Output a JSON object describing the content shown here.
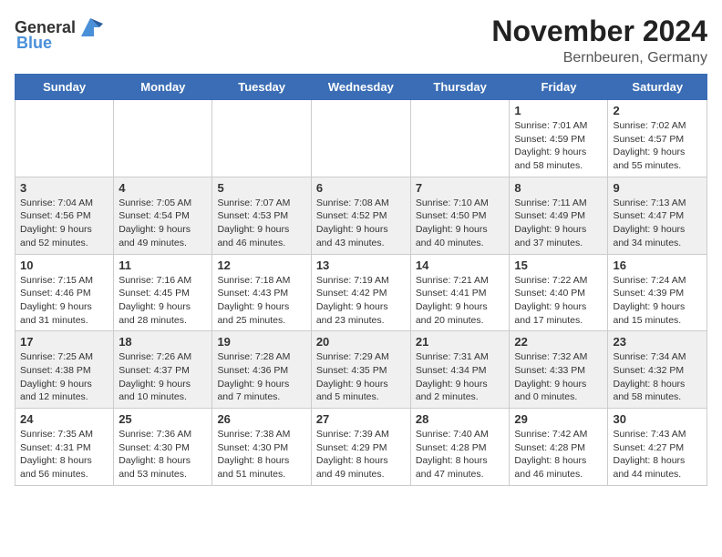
{
  "logo": {
    "general": "General",
    "blue": "Blue"
  },
  "title": "November 2024",
  "location": "Bernbeuren, Germany",
  "days_of_week": [
    "Sunday",
    "Monday",
    "Tuesday",
    "Wednesday",
    "Thursday",
    "Friday",
    "Saturday"
  ],
  "weeks": [
    [
      {
        "day": "",
        "info": ""
      },
      {
        "day": "",
        "info": ""
      },
      {
        "day": "",
        "info": ""
      },
      {
        "day": "",
        "info": ""
      },
      {
        "day": "",
        "info": ""
      },
      {
        "day": "1",
        "info": "Sunrise: 7:01 AM\nSunset: 4:59 PM\nDaylight: 9 hours and 58 minutes."
      },
      {
        "day": "2",
        "info": "Sunrise: 7:02 AM\nSunset: 4:57 PM\nDaylight: 9 hours and 55 minutes."
      }
    ],
    [
      {
        "day": "3",
        "info": "Sunrise: 7:04 AM\nSunset: 4:56 PM\nDaylight: 9 hours and 52 minutes."
      },
      {
        "day": "4",
        "info": "Sunrise: 7:05 AM\nSunset: 4:54 PM\nDaylight: 9 hours and 49 minutes."
      },
      {
        "day": "5",
        "info": "Sunrise: 7:07 AM\nSunset: 4:53 PM\nDaylight: 9 hours and 46 minutes."
      },
      {
        "day": "6",
        "info": "Sunrise: 7:08 AM\nSunset: 4:52 PM\nDaylight: 9 hours and 43 minutes."
      },
      {
        "day": "7",
        "info": "Sunrise: 7:10 AM\nSunset: 4:50 PM\nDaylight: 9 hours and 40 minutes."
      },
      {
        "day": "8",
        "info": "Sunrise: 7:11 AM\nSunset: 4:49 PM\nDaylight: 9 hours and 37 minutes."
      },
      {
        "day": "9",
        "info": "Sunrise: 7:13 AM\nSunset: 4:47 PM\nDaylight: 9 hours and 34 minutes."
      }
    ],
    [
      {
        "day": "10",
        "info": "Sunrise: 7:15 AM\nSunset: 4:46 PM\nDaylight: 9 hours and 31 minutes."
      },
      {
        "day": "11",
        "info": "Sunrise: 7:16 AM\nSunset: 4:45 PM\nDaylight: 9 hours and 28 minutes."
      },
      {
        "day": "12",
        "info": "Sunrise: 7:18 AM\nSunset: 4:43 PM\nDaylight: 9 hours and 25 minutes."
      },
      {
        "day": "13",
        "info": "Sunrise: 7:19 AM\nSunset: 4:42 PM\nDaylight: 9 hours and 23 minutes."
      },
      {
        "day": "14",
        "info": "Sunrise: 7:21 AM\nSunset: 4:41 PM\nDaylight: 9 hours and 20 minutes."
      },
      {
        "day": "15",
        "info": "Sunrise: 7:22 AM\nSunset: 4:40 PM\nDaylight: 9 hours and 17 minutes."
      },
      {
        "day": "16",
        "info": "Sunrise: 7:24 AM\nSunset: 4:39 PM\nDaylight: 9 hours and 15 minutes."
      }
    ],
    [
      {
        "day": "17",
        "info": "Sunrise: 7:25 AM\nSunset: 4:38 PM\nDaylight: 9 hours and 12 minutes."
      },
      {
        "day": "18",
        "info": "Sunrise: 7:26 AM\nSunset: 4:37 PM\nDaylight: 9 hours and 10 minutes."
      },
      {
        "day": "19",
        "info": "Sunrise: 7:28 AM\nSunset: 4:36 PM\nDaylight: 9 hours and 7 minutes."
      },
      {
        "day": "20",
        "info": "Sunrise: 7:29 AM\nSunset: 4:35 PM\nDaylight: 9 hours and 5 minutes."
      },
      {
        "day": "21",
        "info": "Sunrise: 7:31 AM\nSunset: 4:34 PM\nDaylight: 9 hours and 2 minutes."
      },
      {
        "day": "22",
        "info": "Sunrise: 7:32 AM\nSunset: 4:33 PM\nDaylight: 9 hours and 0 minutes."
      },
      {
        "day": "23",
        "info": "Sunrise: 7:34 AM\nSunset: 4:32 PM\nDaylight: 8 hours and 58 minutes."
      }
    ],
    [
      {
        "day": "24",
        "info": "Sunrise: 7:35 AM\nSunset: 4:31 PM\nDaylight: 8 hours and 56 minutes."
      },
      {
        "day": "25",
        "info": "Sunrise: 7:36 AM\nSunset: 4:30 PM\nDaylight: 8 hours and 53 minutes."
      },
      {
        "day": "26",
        "info": "Sunrise: 7:38 AM\nSunset: 4:30 PM\nDaylight: 8 hours and 51 minutes."
      },
      {
        "day": "27",
        "info": "Sunrise: 7:39 AM\nSunset: 4:29 PM\nDaylight: 8 hours and 49 minutes."
      },
      {
        "day": "28",
        "info": "Sunrise: 7:40 AM\nSunset: 4:28 PM\nDaylight: 8 hours and 47 minutes."
      },
      {
        "day": "29",
        "info": "Sunrise: 7:42 AM\nSunset: 4:28 PM\nDaylight: 8 hours and 46 minutes."
      },
      {
        "day": "30",
        "info": "Sunrise: 7:43 AM\nSunset: 4:27 PM\nDaylight: 8 hours and 44 minutes."
      }
    ]
  ]
}
